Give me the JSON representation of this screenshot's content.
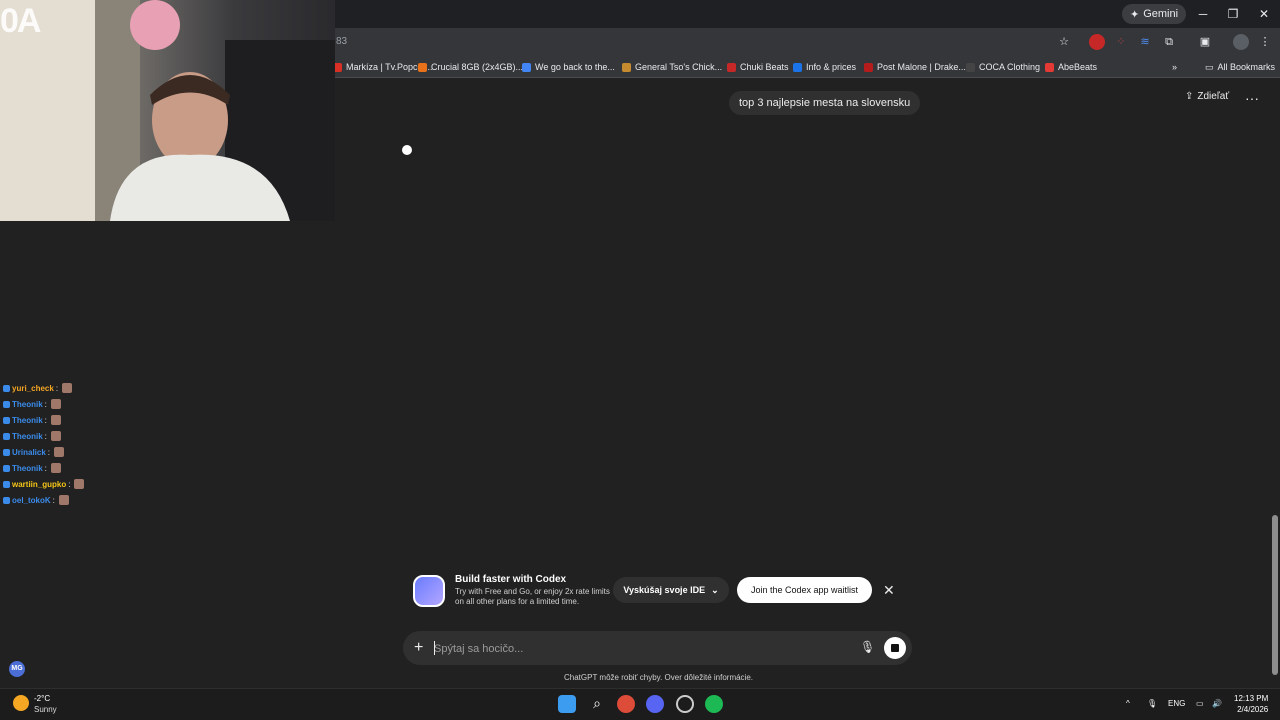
{
  "browser": {
    "gemini_label": "Gemini",
    "url_fragment": "83",
    "bookmarks": [
      {
        "label": "Markíza | Tv.Popcor...",
        "color": "#d93025"
      },
      {
        "label": "Crucial 8GB (2x4GB)...",
        "color": "#e8711a"
      },
      {
        "label": "We go back to the...",
        "color": "#4285f4"
      },
      {
        "label": "General Tso's Chick...",
        "color": "#c58b2e"
      },
      {
        "label": "Chuki Beats",
        "color": "#c62828"
      },
      {
        "label": "Info & prices",
        "color": "#1a73e8"
      },
      {
        "label": "Post Malone | Drake...",
        "color": "#b71c1c"
      },
      {
        "label": "COCA Clothing",
        "color": "#444444"
      },
      {
        "label": "AbeBeats",
        "color": "#e53935"
      }
    ],
    "all_bookmarks_label": "All Bookmarks"
  },
  "webcam": {
    "overlay_text": "0A"
  },
  "chat": {
    "user_message": "top 3 najlepsie mesta na slovensku",
    "share_label": "Zdieľať"
  },
  "codex_banner": {
    "title": "Build faster with Codex",
    "subtitle": "Try with Free and Go, or enjoy 2x rate limits on all other plans for a limited time.",
    "try_ide_label": "Vyskúšaj svoje IDE",
    "join_label": "Join the Codex app waitlist"
  },
  "composer": {
    "placeholder": "Spýtaj sa hocičo...",
    "disclaimer": "ChatGPT môže robiť chyby. Over dôležité informácie."
  },
  "stream_chat": [
    {
      "user": "yuri_check",
      "color": "#f5a623"
    },
    {
      "user": "Theonik",
      "color": "#3b8beb"
    },
    {
      "user": "Theonik",
      "color": "#3b8beb"
    },
    {
      "user": "Theonik",
      "color": "#3b8beb"
    },
    {
      "user": "Urinalick",
      "color": "#3b8beb"
    },
    {
      "user": "Theonik",
      "color": "#3b8beb"
    },
    {
      "user": "wartiin_gupko",
      "color": "#f5c518"
    },
    {
      "user": "oel_tokoK",
      "color": "#3b8beb"
    }
  ],
  "stream_avatar": "MG",
  "taskbar": {
    "weather_temp": "-2°C",
    "weather_desc": "Sunny",
    "lang": "ENG",
    "time": "12:13 PM",
    "date": "2/4/2026"
  }
}
